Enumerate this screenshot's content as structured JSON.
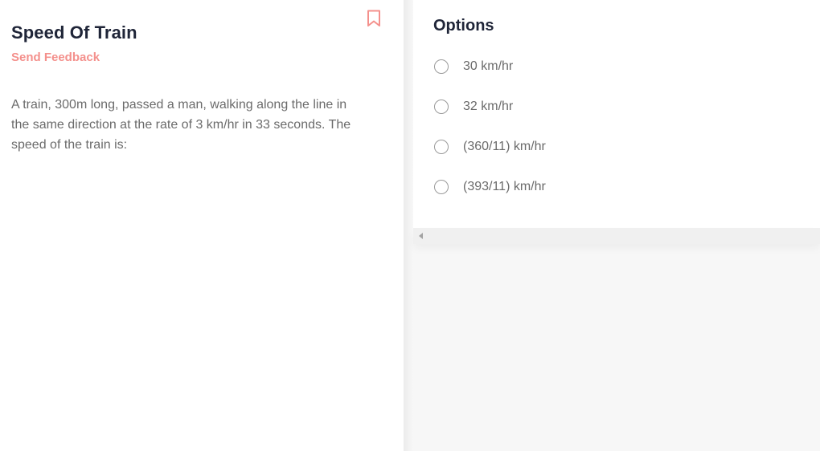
{
  "question": {
    "title": "Speed Of Train",
    "feedback_label": "Send Feedback",
    "text": "A train, 300m long, passed a man, walking along the line in the same direction at the rate of 3 km/hr in 33 seconds. The speed of the train is:"
  },
  "options": {
    "title": "Options",
    "items": [
      {
        "label": "30 km/hr"
      },
      {
        "label": "32 km/hr"
      },
      {
        "label": "(360/11) km/hr"
      },
      {
        "label": "(393/11) km/hr"
      }
    ]
  },
  "colors": {
    "accent": "#f4908c",
    "heading": "#1f2538",
    "body_text": "#6b6b6b"
  },
  "icons": {
    "bookmark": "bookmark-icon",
    "scroll_left": "scroll-left-arrow-icon"
  }
}
